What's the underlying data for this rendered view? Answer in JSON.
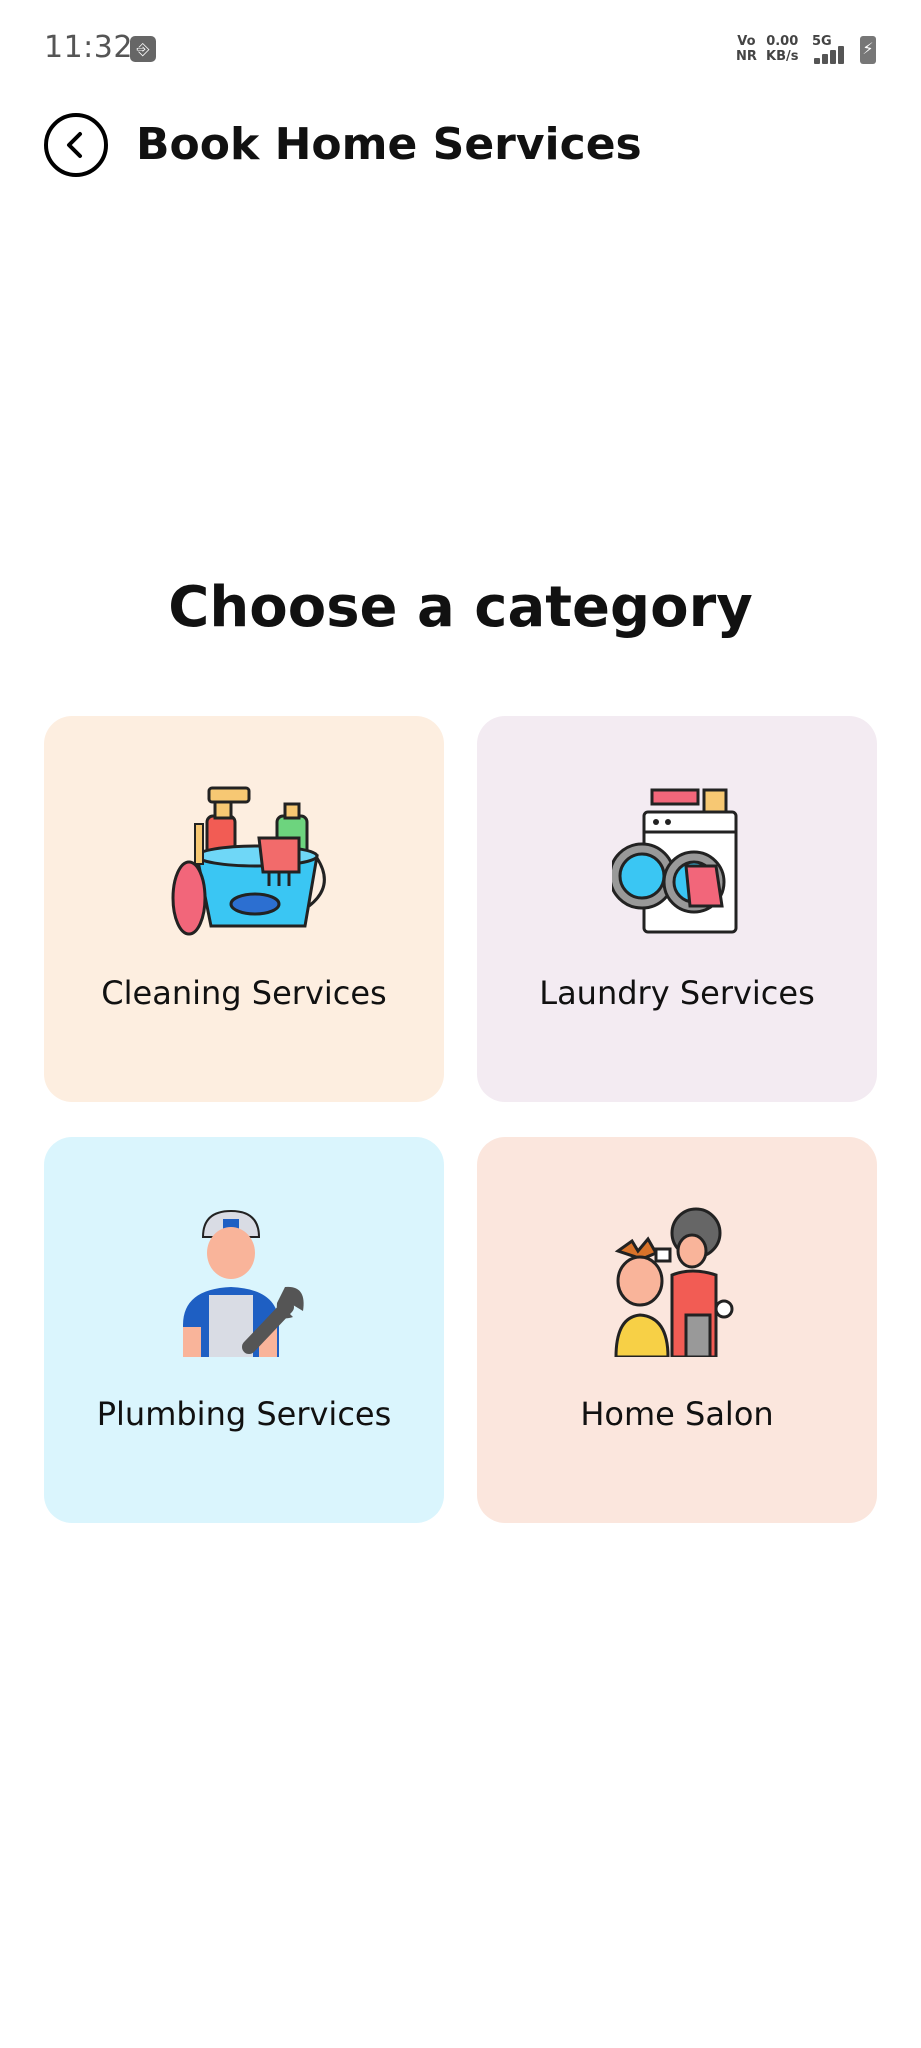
{
  "status_bar": {
    "time": "11:32",
    "net_type_top": "Vo",
    "net_type_bottom": "NR",
    "speed_value": "0.00",
    "speed_unit": "KB/s",
    "signal_label": "5G"
  },
  "header": {
    "title": "Book Home Services"
  },
  "main": {
    "heading": "Choose a category",
    "categories": [
      {
        "label": "Cleaning Services",
        "color": "#fdeee0",
        "icon": "cleaning-bucket-icon"
      },
      {
        "label": "Laundry Services",
        "color": "#f3ebf2",
        "icon": "washing-machine-icon"
      },
      {
        "label": "Plumbing Services",
        "color": "#daf5fd",
        "icon": "plumber-icon"
      },
      {
        "label": "Home Salon",
        "color": "#fbe6dd",
        "icon": "hair-salon-icon"
      }
    ]
  }
}
